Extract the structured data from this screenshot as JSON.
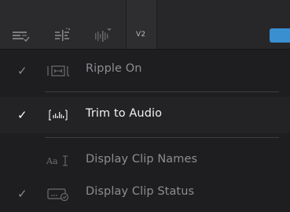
{
  "toolbar": {
    "track_label": "V2",
    "icons": [
      "timeline-view-options-icon",
      "snapping-icon",
      "audio-waveform-icon"
    ],
    "accent_color": "#3a8fd0"
  },
  "menu": {
    "items": [
      {
        "label": "Ripple On",
        "checked": true,
        "icon": "ripple-icon",
        "enabled": false
      },
      {
        "label": "Trim to Audio",
        "checked": true,
        "icon": "trim-audio-icon",
        "enabled": true
      },
      {
        "label": "Display Clip Names",
        "checked": false,
        "icon": "clip-names-icon",
        "enabled": false
      },
      {
        "label": "Display Clip Status",
        "checked": true,
        "icon": "clip-status-icon",
        "enabled": false
      }
    ],
    "checkmark": "✓",
    "colors": {
      "active_text": "#f2f2f4",
      "dim_text": "#8d8d92",
      "active_check": "#ffffff",
      "dim_check": "#8a8a8f"
    }
  }
}
